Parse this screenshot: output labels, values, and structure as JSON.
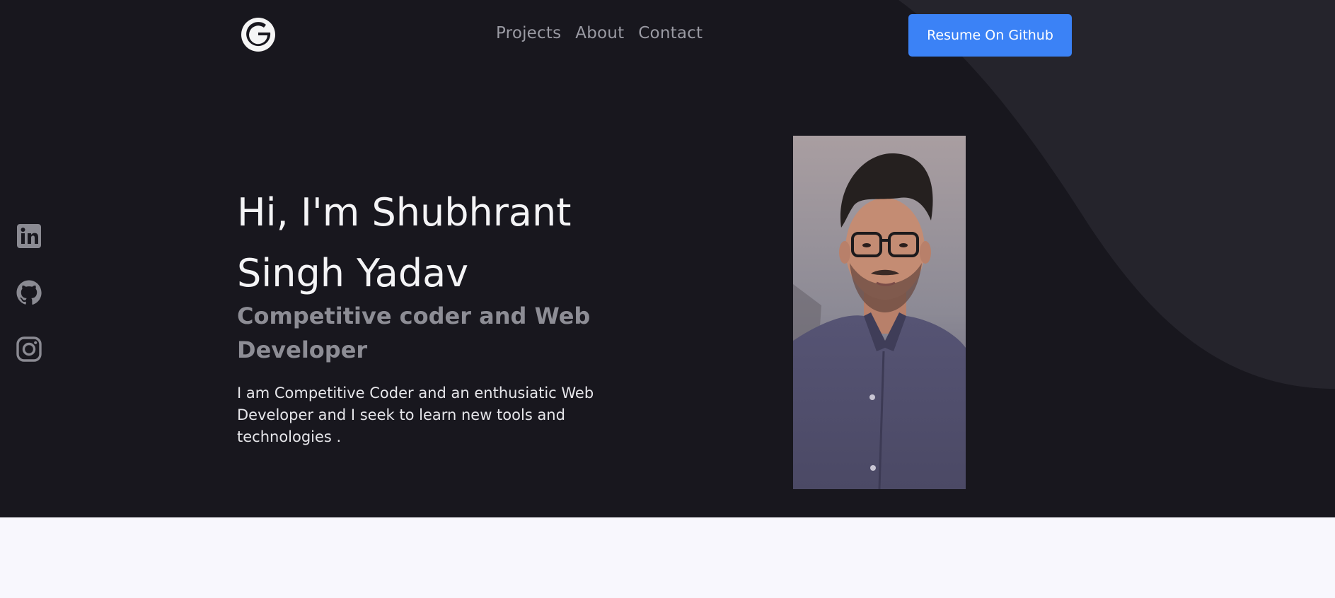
{
  "header": {
    "logo_letter": "G",
    "nav": [
      {
        "label": "Projects"
      },
      {
        "label": "About"
      },
      {
        "label": "Contact"
      }
    ],
    "resume_button_label": "Resume On Github"
  },
  "social": [
    {
      "name": "linkedin-icon"
    },
    {
      "name": "github-icon"
    },
    {
      "name": "instagram-icon"
    }
  ],
  "hero": {
    "headline": "Hi, I'm Shubhrant Singh Yadav",
    "subtitle": "Competitive coder and Web Developer",
    "description": "I am Competitive Coder and an enthusiatic Web Developer and I seek to learn new tools and technologies ."
  },
  "colors": {
    "hero_background": "#18171e",
    "accent_shape": "#25242c",
    "button": "#3b82f6",
    "page_background": "#f8f7fd"
  }
}
